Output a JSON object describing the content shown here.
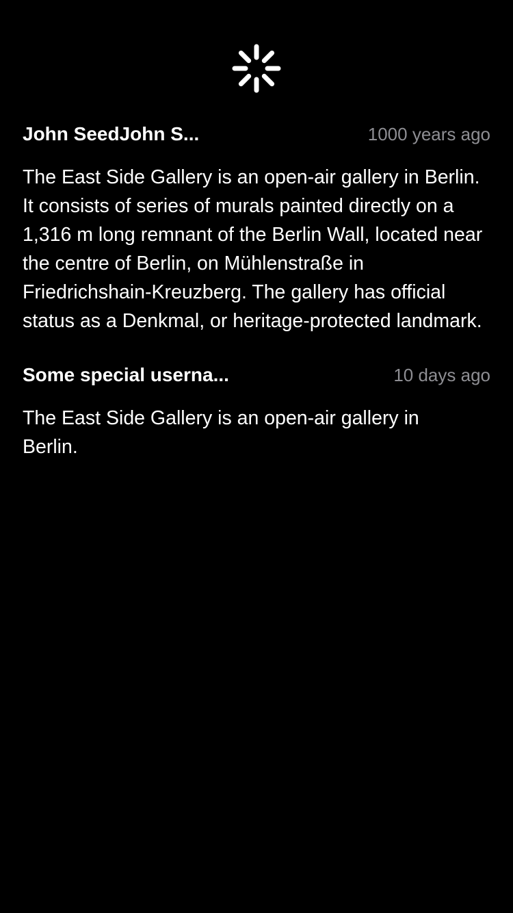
{
  "spinner": {
    "icon": "loading-spinner-icon",
    "color": "#ffffff"
  },
  "comments": [
    {
      "username": "John SeedJohn S...",
      "timestamp": "1000 years ago",
      "body": "The East Side Gallery is an open-air gallery in Berlin. It consists of series of murals painted directly on a 1,316 m long remnant of the Berlin Wall, located near the centre of Berlin, on Mühlenstraße in Friedrichshain-Kreuzberg. The gallery has official status as a Denkmal, or heritage-protected landmark."
    },
    {
      "username": "Some special userna...",
      "timestamp": "10 days ago",
      "body": "The East Side Gallery is an open-air gallery in Berlin."
    }
  ],
  "colors": {
    "background": "#000000",
    "text": "#ffffff",
    "secondary_text": "#8e8e93"
  }
}
